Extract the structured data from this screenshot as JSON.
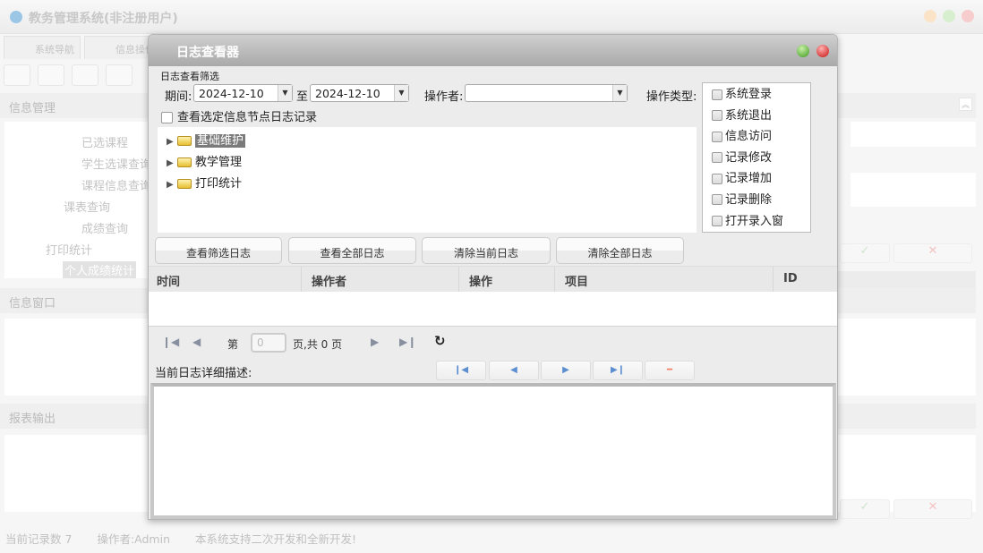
{
  "app": {
    "title": "教务管理系统(非注册用户)",
    "tabs": [
      "系统导航",
      "信息操作"
    ]
  },
  "left": {
    "section_info": "信息管理",
    "tree": [
      "已选课程",
      "学生选课查询",
      "课程信息查询",
      "课表查询",
      "成绩查询",
      "打印统计",
      "个人成绩统计"
    ],
    "section_window": "信息窗口",
    "section_report": "报表输出"
  },
  "status": {
    "records": "当前记录数 7",
    "operator": "操作者:Admin",
    "slogan": "本系统支持二次开发和全新开发!"
  },
  "dialog": {
    "title": "日志查看器",
    "filter_label": "日志查看筛选",
    "period_label": "期间:",
    "date_from": "2024-12-10",
    "to_label": "至",
    "date_to": "2024-12-10",
    "operator_label": "操作者:",
    "operator_value": "",
    "optype_label": "操作类型:",
    "optypes": [
      "系统登录",
      "系统退出",
      "信息访问",
      "记录修改",
      "记录增加",
      "记录删除",
      "打开录入窗"
    ],
    "node_check_label": "查看选定信息节点日志记录",
    "tree": [
      "基础维护",
      "教学管理",
      "打印统计"
    ],
    "buttons": [
      "查看筛选日志",
      "查看全部日志",
      "清除当前日志",
      "清除全部日志"
    ],
    "columns": [
      "时间",
      "操作者",
      "操作",
      "项目",
      "ID"
    ],
    "pager": {
      "page_prefix": "第",
      "page_value": "0",
      "page_suffix": "页,共 0 页"
    },
    "detail_label": "当前日志详细描述:",
    "detail_text": ""
  }
}
